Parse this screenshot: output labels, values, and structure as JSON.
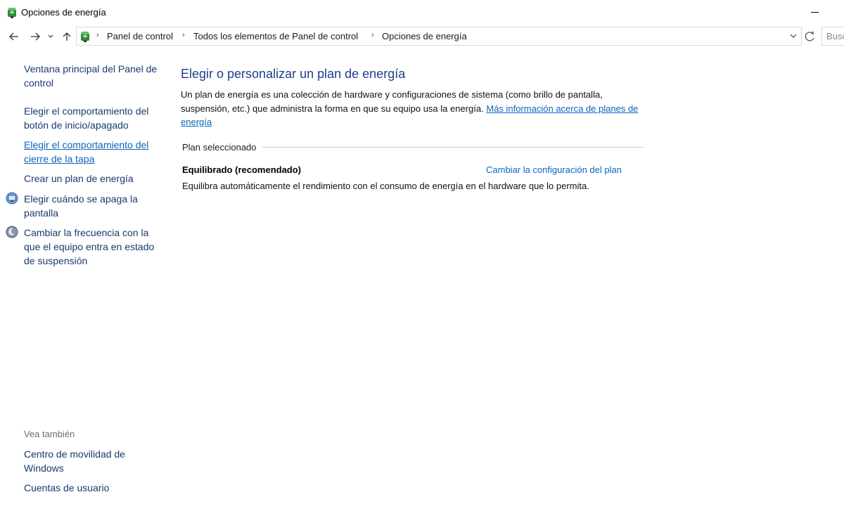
{
  "window": {
    "title": "Opciones de energía",
    "icon": "power-options-icon"
  },
  "navigation": {
    "back_icon": "back-arrow-icon",
    "forward_icon": "forward-arrow-icon",
    "recent_icon": "chevron-down-icon",
    "up_icon": "up-arrow-icon"
  },
  "address": {
    "breadcrumbs": [
      "Panel de control",
      "Todos los elementos de Panel de control",
      "Opciones de energía"
    ],
    "search_placeholder": "Buscar en el Panel de control"
  },
  "sidebar": {
    "links": [
      {
        "label": "Ventana principal del Panel de control"
      },
      {
        "label": "Elegir el comportamiento del botón de inicio/apagado"
      },
      {
        "label": "Elegir el comportamiento del cierre de la tapa"
      },
      {
        "label": "Crear un plan de energía"
      },
      {
        "label": "Elegir cuándo se apaga la pantalla",
        "icon": "display-icon"
      },
      {
        "label": "Cambiar la frecuencia con la que el equipo entra en estado de suspensión",
        "icon": "moon-sleep-icon"
      }
    ],
    "see_also_label": "Vea también",
    "see_also": [
      {
        "label": "Centro de movilidad de Windows"
      },
      {
        "label": "Cuentas de usuario"
      }
    ]
  },
  "main": {
    "heading": "Elegir o personalizar un plan de energía",
    "intro_text": "Un plan de energía es una colección de hardware y configuraciones de sistema (como brillo de pantalla, suspensión, etc.) que administra la forma en que su equipo usa la energía.",
    "intro_link": "Más información acerca de planes de energía",
    "plan_section_label": "Plan seleccionado",
    "plan": {
      "name": "Equilibrado (recomendado)",
      "change_link": "Cambiar la configuración del plan",
      "description": "Equilibra automáticamente el rendimiento con el consumo de energía en el hardware que lo permita."
    }
  },
  "colors": {
    "heading": "#1e3f8a",
    "link": "#0a66c2",
    "sidebar_link": "#1a3a6e"
  }
}
